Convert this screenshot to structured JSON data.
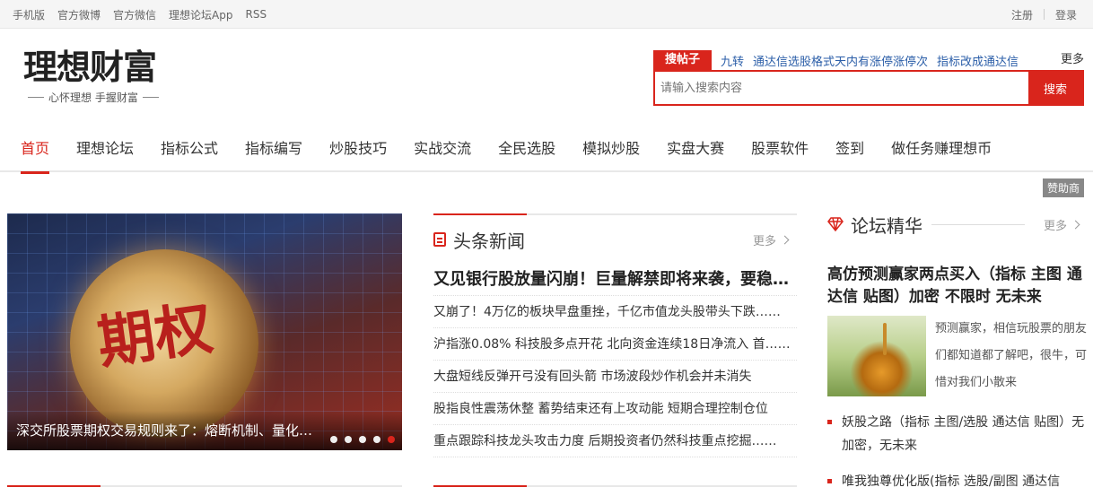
{
  "topbar": {
    "left_links": [
      "手机版",
      "官方微博",
      "官方微信",
      "理想论坛App",
      "RSS"
    ],
    "register": "注册",
    "login": "登录"
  },
  "logo": {
    "name": "理想财富",
    "slogan": "心怀理想  手握财富"
  },
  "search": {
    "tab_label": "搜帖子",
    "hot_links": [
      "九转",
      "通达信选股格式天内有涨停涨停次",
      "指标改成通达信"
    ],
    "more": "更多",
    "placeholder": "请输入搜索内容",
    "button": "搜索"
  },
  "nav": {
    "items": [
      "首页",
      "理想论坛",
      "指标公式",
      "指标编写",
      "炒股技巧",
      "实战交流",
      "全民选股",
      "模拟炒股",
      "实盘大赛",
      "股票软件",
      "签到",
      "做任务赚理想币"
    ],
    "active_index": 0
  },
  "sponsor": "赞助商",
  "slider": {
    "image_text": "期权",
    "caption": "深交所股票期权交易规则来了：熔断机制、量化交易",
    "dots": 5,
    "active_dot": 4
  },
  "news": {
    "title": "头条新闻",
    "more": "更多",
    "headline": "又见银行股放量闪崩！巨量解禁即将来袭，要稳住！",
    "items": [
      "又崩了！4万亿的板块早盘重挫，千亿市值龙头股带头下跌……",
      "沪指涨0.08% 科技股多点开花 北向资金连续18日净流入 首……",
      "大盘短线反弹开弓没有回头箭 市场波段炒作机会并未消失",
      "股指良性震荡休整 蓄势结束还有上攻动能 短期合理控制仓位",
      "重点跟踪科技龙头攻击力度 后期投资者仍然科技重点挖掘……"
    ]
  },
  "forum": {
    "title": "论坛精华",
    "more": "更多",
    "feature_title": "高仿预测赢家两点买入（指标 主图 通达信 贴图）加密 不限时 无未来",
    "feature_text": "预测赢家，相信玩股票的朋友们都知道都了解吧，很牛，可惜对我们小散来",
    "list": [
      "妖股之路（指标 主图/选股 通达信 贴图）无加密，无未来",
      "唯我独尊优化版(指标 选股/副图 通达信"
    ]
  },
  "colors": {
    "accent": "#d9251c",
    "link": "#2b5ea8"
  }
}
